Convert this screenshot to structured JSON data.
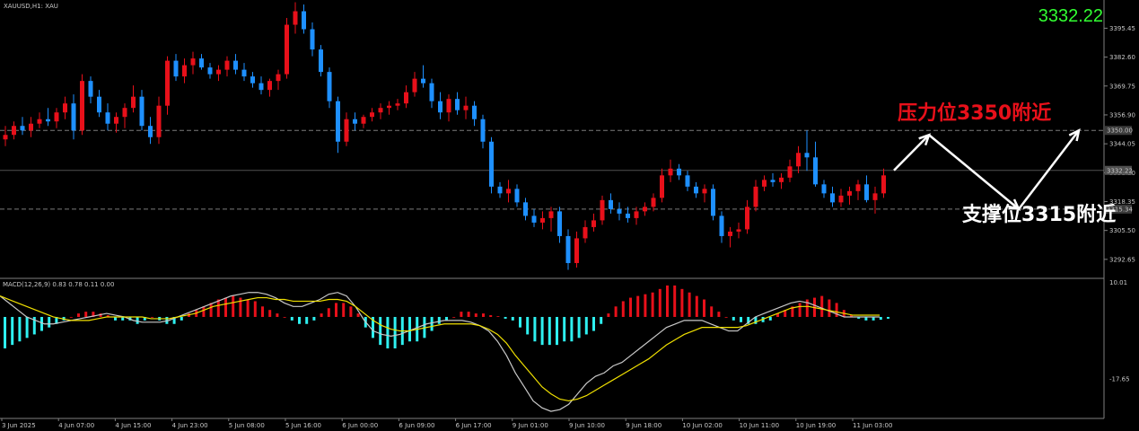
{
  "header": {
    "symbol_label": "XAUUSD,H1: XAU",
    "current_price": "3332.22",
    "price_color": "#32ff32"
  },
  "chart_data": [
    {
      "type": "candlestick",
      "title": "",
      "ylim": [
        3285,
        3408
      ],
      "up_color": "#e8101a",
      "down_color": "#1e90ff",
      "yticks": [
        "3395.45",
        "3382.60",
        "3369.75",
        "3356.90",
        "3344.05",
        "3331.20",
        "3318.35",
        "3305.50",
        "3292.65"
      ],
      "price_labels": {
        "resistance": "3350.00",
        "current": "3332.22",
        "support": "3315.34"
      },
      "levels": {
        "resistance": 3350,
        "current": 3332.22,
        "support": 3315
      },
      "candles": [
        [
          3346,
          3352,
          3343,
          3348
        ],
        [
          3348,
          3354,
          3346,
          3352
        ],
        [
          3352,
          3356,
          3348,
          3350
        ],
        [
          3350,
          3356,
          3347,
          3353
        ],
        [
          3353,
          3358,
          3351,
          3355
        ],
        [
          3355,
          3360,
          3352,
          3354
        ],
        [
          3354,
          3360,
          3351,
          3358
        ],
        [
          3358,
          3365,
          3355,
          3362
        ],
        [
          3362,
          3366,
          3346,
          3350
        ],
        [
          3350,
          3375,
          3348,
          3372
        ],
        [
          3372,
          3374,
          3362,
          3365
        ],
        [
          3365,
          3368,
          3356,
          3358
        ],
        [
          3358,
          3362,
          3350,
          3353
        ],
        [
          3353,
          3358,
          3349,
          3356
        ],
        [
          3356,
          3362,
          3351,
          3360
        ],
        [
          3360,
          3370,
          3358,
          3365
        ],
        [
          3365,
          3368,
          3350,
          3352
        ],
        [
          3352,
          3356,
          3344,
          3347
        ],
        [
          3347,
          3365,
          3344,
          3361
        ],
        [
          3361,
          3383,
          3357,
          3381
        ],
        [
          3381,
          3384,
          3372,
          3374
        ],
        [
          3374,
          3382,
          3371,
          3379
        ],
        [
          3379,
          3385,
          3375,
          3382
        ],
        [
          3382,
          3384,
          3377,
          3378
        ],
        [
          3378,
          3380,
          3373,
          3375
        ],
        [
          3375,
          3379,
          3372,
          3377
        ],
        [
          3377,
          3383,
          3374,
          3381
        ],
        [
          3381,
          3384,
          3375,
          3377
        ],
        [
          3377,
          3380,
          3372,
          3374
        ],
        [
          3374,
          3376,
          3369,
          3371
        ],
        [
          3371,
          3374,
          3366,
          3368
        ],
        [
          3368,
          3373,
          3365,
          3372
        ],
        [
          3372,
          3377,
          3368,
          3375
        ],
        [
          3375,
          3400,
          3373,
          3397
        ],
        [
          3397,
          3407,
          3393,
          3403
        ],
        [
          3403,
          3406,
          3393,
          3395
        ],
        [
          3395,
          3398,
          3383,
          3386
        ],
        [
          3386,
          3388,
          3374,
          3376
        ],
        [
          3376,
          3378,
          3360,
          3363
        ],
        [
          3363,
          3365,
          3340,
          3345
        ],
        [
          3345,
          3358,
          3343,
          3355
        ],
        [
          3355,
          3358,
          3350,
          3353
        ],
        [
          3353,
          3357,
          3351,
          3356
        ],
        [
          3356,
          3360,
          3354,
          3358
        ],
        [
          3358,
          3362,
          3355,
          3360
        ],
        [
          3360,
          3363,
          3357,
          3361
        ],
        [
          3361,
          3364,
          3359,
          3362
        ],
        [
          3362,
          3370,
          3360,
          3367
        ],
        [
          3367,
          3376,
          3365,
          3373
        ],
        [
          3373,
          3379,
          3369,
          3371
        ],
        [
          3371,
          3373,
          3360,
          3363
        ],
        [
          3363,
          3367,
          3355,
          3358
        ],
        [
          3358,
          3366,
          3354,
          3364
        ],
        [
          3364,
          3367,
          3357,
          3359
        ],
        [
          3359,
          3365,
          3355,
          3361
        ],
        [
          3361,
          3363,
          3352,
          3355
        ],
        [
          3355,
          3357,
          3342,
          3345
        ],
        [
          3345,
          3347,
          3322,
          3325
        ],
        [
          3325,
          3327,
          3320,
          3322
        ],
        [
          3322,
          3328,
          3318,
          3324
        ],
        [
          3324,
          3326,
          3316,
          3318
        ],
        [
          3318,
          3320,
          3310,
          3312
        ],
        [
          3312,
          3315,
          3307,
          3309
        ],
        [
          3309,
          3314,
          3306,
          3311
        ],
        [
          3311,
          3316,
          3305,
          3314
        ],
        [
          3314,
          3316,
          3300,
          3303
        ],
        [
          3303,
          3306,
          3288,
          3291
        ],
        [
          3291,
          3305,
          3289,
          3302
        ],
        [
          3302,
          3310,
          3300,
          3307
        ],
        [
          3307,
          3313,
          3305,
          3310
        ],
        [
          3310,
          3321,
          3308,
          3319
        ],
        [
          3319,
          3322,
          3313,
          3315
        ],
        [
          3315,
          3318,
          3310,
          3313
        ],
        [
          3313,
          3316,
          3309,
          3311
        ],
        [
          3311,
          3316,
          3308,
          3314
        ],
        [
          3314,
          3318,
          3312,
          3316
        ],
        [
          3316,
          3322,
          3314,
          3320
        ],
        [
          3320,
          3333,
          3318,
          3330
        ],
        [
          3330,
          3337,
          3327,
          3333
        ],
        [
          3333,
          3335,
          3328,
          3330
        ],
        [
          3330,
          3332,
          3323,
          3325
        ],
        [
          3325,
          3327,
          3320,
          3322
        ],
        [
          3322,
          3326,
          3318,
          3324
        ],
        [
          3324,
          3326,
          3310,
          3312
        ],
        [
          3312,
          3314,
          3300,
          3303
        ],
        [
          3303,
          3307,
          3298,
          3305
        ],
        [
          3305,
          3309,
          3302,
          3306
        ],
        [
          3306,
          3319,
          3304,
          3316
        ],
        [
          3316,
          3328,
          3314,
          3325
        ],
        [
          3325,
          3330,
          3323,
          3328
        ],
        [
          3328,
          3331,
          3325,
          3327
        ],
        [
          3327,
          3331,
          3324,
          3329
        ],
        [
          3329,
          3337,
          3327,
          3334
        ],
        [
          3334,
          3343,
          3331,
          3340
        ],
        [
          3340,
          3350,
          3332,
          3338
        ],
        [
          3338,
          3345,
          3325,
          3326
        ],
        [
          3326,
          3328,
          3320,
          3322
        ],
        [
          3322,
          3325,
          3316,
          3318
        ],
        [
          3318,
          3324,
          3316,
          3321
        ],
        [
          3321,
          3325,
          3317,
          3323
        ],
        [
          3323,
          3328,
          3319,
          3326
        ],
        [
          3326,
          3330,
          3318,
          3319
        ],
        [
          3319,
          3325,
          3313,
          3322
        ],
        [
          3322,
          3333,
          3320,
          3330
        ]
      ]
    },
    {
      "type": "bar",
      "title": "MACD(12,26,9) 0.83 0.78 0.11 0.00",
      "ylim": [
        -28,
        10.01
      ],
      "yticks": [
        "10.01",
        "-17.65"
      ],
      "histogram_colors": {
        "positive": "#e8101a",
        "negative": "#2ef0f0"
      },
      "series": [
        {
          "name": "MACD",
          "color": "#c8c8c8"
        },
        {
          "name": "Signal",
          "color": "#f0e000"
        }
      ],
      "histogram": [
        -9,
        -8,
        -7,
        -6,
        -5,
        -4,
        -3,
        -2,
        -1,
        0,
        1,
        1.5,
        1.5,
        1,
        0.5,
        -1,
        -1,
        -1,
        -2,
        -1,
        0,
        -1,
        -2,
        -2,
        -1,
        1,
        2,
        3,
        4,
        5,
        5.5,
        6,
        5.5,
        5,
        4.5,
        3,
        2,
        1,
        0,
        -1,
        -2,
        -2,
        -1,
        1,
        2.5,
        4,
        4,
        3,
        1,
        -3,
        -6,
        -8,
        -9,
        -9,
        -8,
        -7,
        -7,
        -6,
        -4,
        -2,
        -1,
        0,
        1.5,
        1.5,
        1,
        1,
        0.5,
        0.2,
        -0.5,
        -1,
        -3,
        -5,
        -7,
        -8,
        -8,
        -8,
        -7,
        -7,
        -6,
        -5,
        -4,
        -2,
        1,
        3,
        4.5,
        5.5,
        6,
        6.5,
        7,
        8,
        9,
        9,
        8,
        7,
        6,
        5,
        3,
        1.5,
        0,
        -1,
        -1.5,
        -2,
        -2,
        -1.5,
        -1,
        1,
        2,
        3,
        4,
        5,
        5.5,
        6,
        5,
        4,
        2,
        0.5,
        -0.5,
        -1,
        -1,
        -0.8,
        -0.5
      ],
      "macd_line": [
        6,
        4,
        2,
        0,
        -1,
        -2,
        -2,
        -1.5,
        -1,
        -0.5,
        0,
        0.5,
        1,
        0.5,
        0,
        -1,
        -1.5,
        -1.5,
        -1.5,
        -1,
        0,
        1,
        2,
        3,
        4,
        5,
        6,
        6.5,
        7,
        7,
        6.5,
        5.5,
        4,
        3,
        3,
        4,
        5,
        6.5,
        7,
        6,
        3,
        -1,
        -4,
        -5,
        -5.5,
        -5,
        -4,
        -3,
        -2,
        -1.5,
        -1,
        -1,
        -1,
        -1.5,
        -2.5,
        -4,
        -7,
        -11,
        -16,
        -20,
        -24,
        -26,
        -27,
        -26.5,
        -25,
        -22,
        -19,
        -17,
        -16,
        -14,
        -13,
        -11,
        -9,
        -7,
        -5,
        -3,
        -2,
        -1,
        -1,
        -1,
        -2,
        -3,
        -4,
        -4,
        -2,
        0,
        1,
        2,
        3,
        4,
        4.5,
        4,
        3,
        2,
        1,
        0,
        0,
        0,
        0,
        0
      ],
      "signal_line": [
        6,
        5,
        4,
        3,
        2,
        1,
        0,
        -0.5,
        -1,
        -1,
        -1,
        -0.5,
        0,
        0,
        0,
        0,
        0,
        -0.5,
        -0.5,
        -0.5,
        0,
        0.5,
        1,
        2,
        3,
        3.5,
        4,
        4.5,
        5,
        5.5,
        5.5,
        5,
        5,
        4.5,
        4.5,
        4.5,
        4.5,
        5,
        5,
        4.5,
        3,
        1,
        -1,
        -2.5,
        -3.5,
        -4,
        -4,
        -3.5,
        -3,
        -2.5,
        -2,
        -2,
        -2,
        -2,
        -2.5,
        -3.5,
        -5,
        -7.5,
        -11,
        -14,
        -17,
        -20,
        -22,
        -23.5,
        -24,
        -23.5,
        -22.5,
        -21,
        -19.5,
        -18,
        -16.5,
        -15,
        -13.5,
        -12,
        -10,
        -8,
        -6.5,
        -5,
        -4,
        -3,
        -3,
        -3,
        -3,
        -3,
        -2.5,
        -1.5,
        -0.5,
        0.5,
        1.5,
        2.5,
        3,
        3,
        2.5,
        2,
        1.5,
        1,
        0.5,
        0.5,
        0.5,
        0.5
      ]
    }
  ],
  "time_axis": [
    "3 Jun 2025",
    "4 Jun 07:00",
    "4 Jun 15:00",
    "4 Jun 23:00",
    "5 Jun 08:00",
    "5 Jun 16:00",
    "6 Jun 00:00",
    "6 Jun 09:00",
    "6 Jun 17:00",
    "9 Jun 01:00",
    "9 Jun 10:00",
    "9 Jun 18:00",
    "10 Jun 02:00",
    "10 Jun 11:00",
    "10 Jun 19:00",
    "11 Jun 03:00"
  ],
  "annotations": {
    "resistance_text": "压力位3350附近",
    "resistance_color": "#e8101a",
    "support_text": "支撑位3315附近",
    "support_color": "#ffffff"
  }
}
